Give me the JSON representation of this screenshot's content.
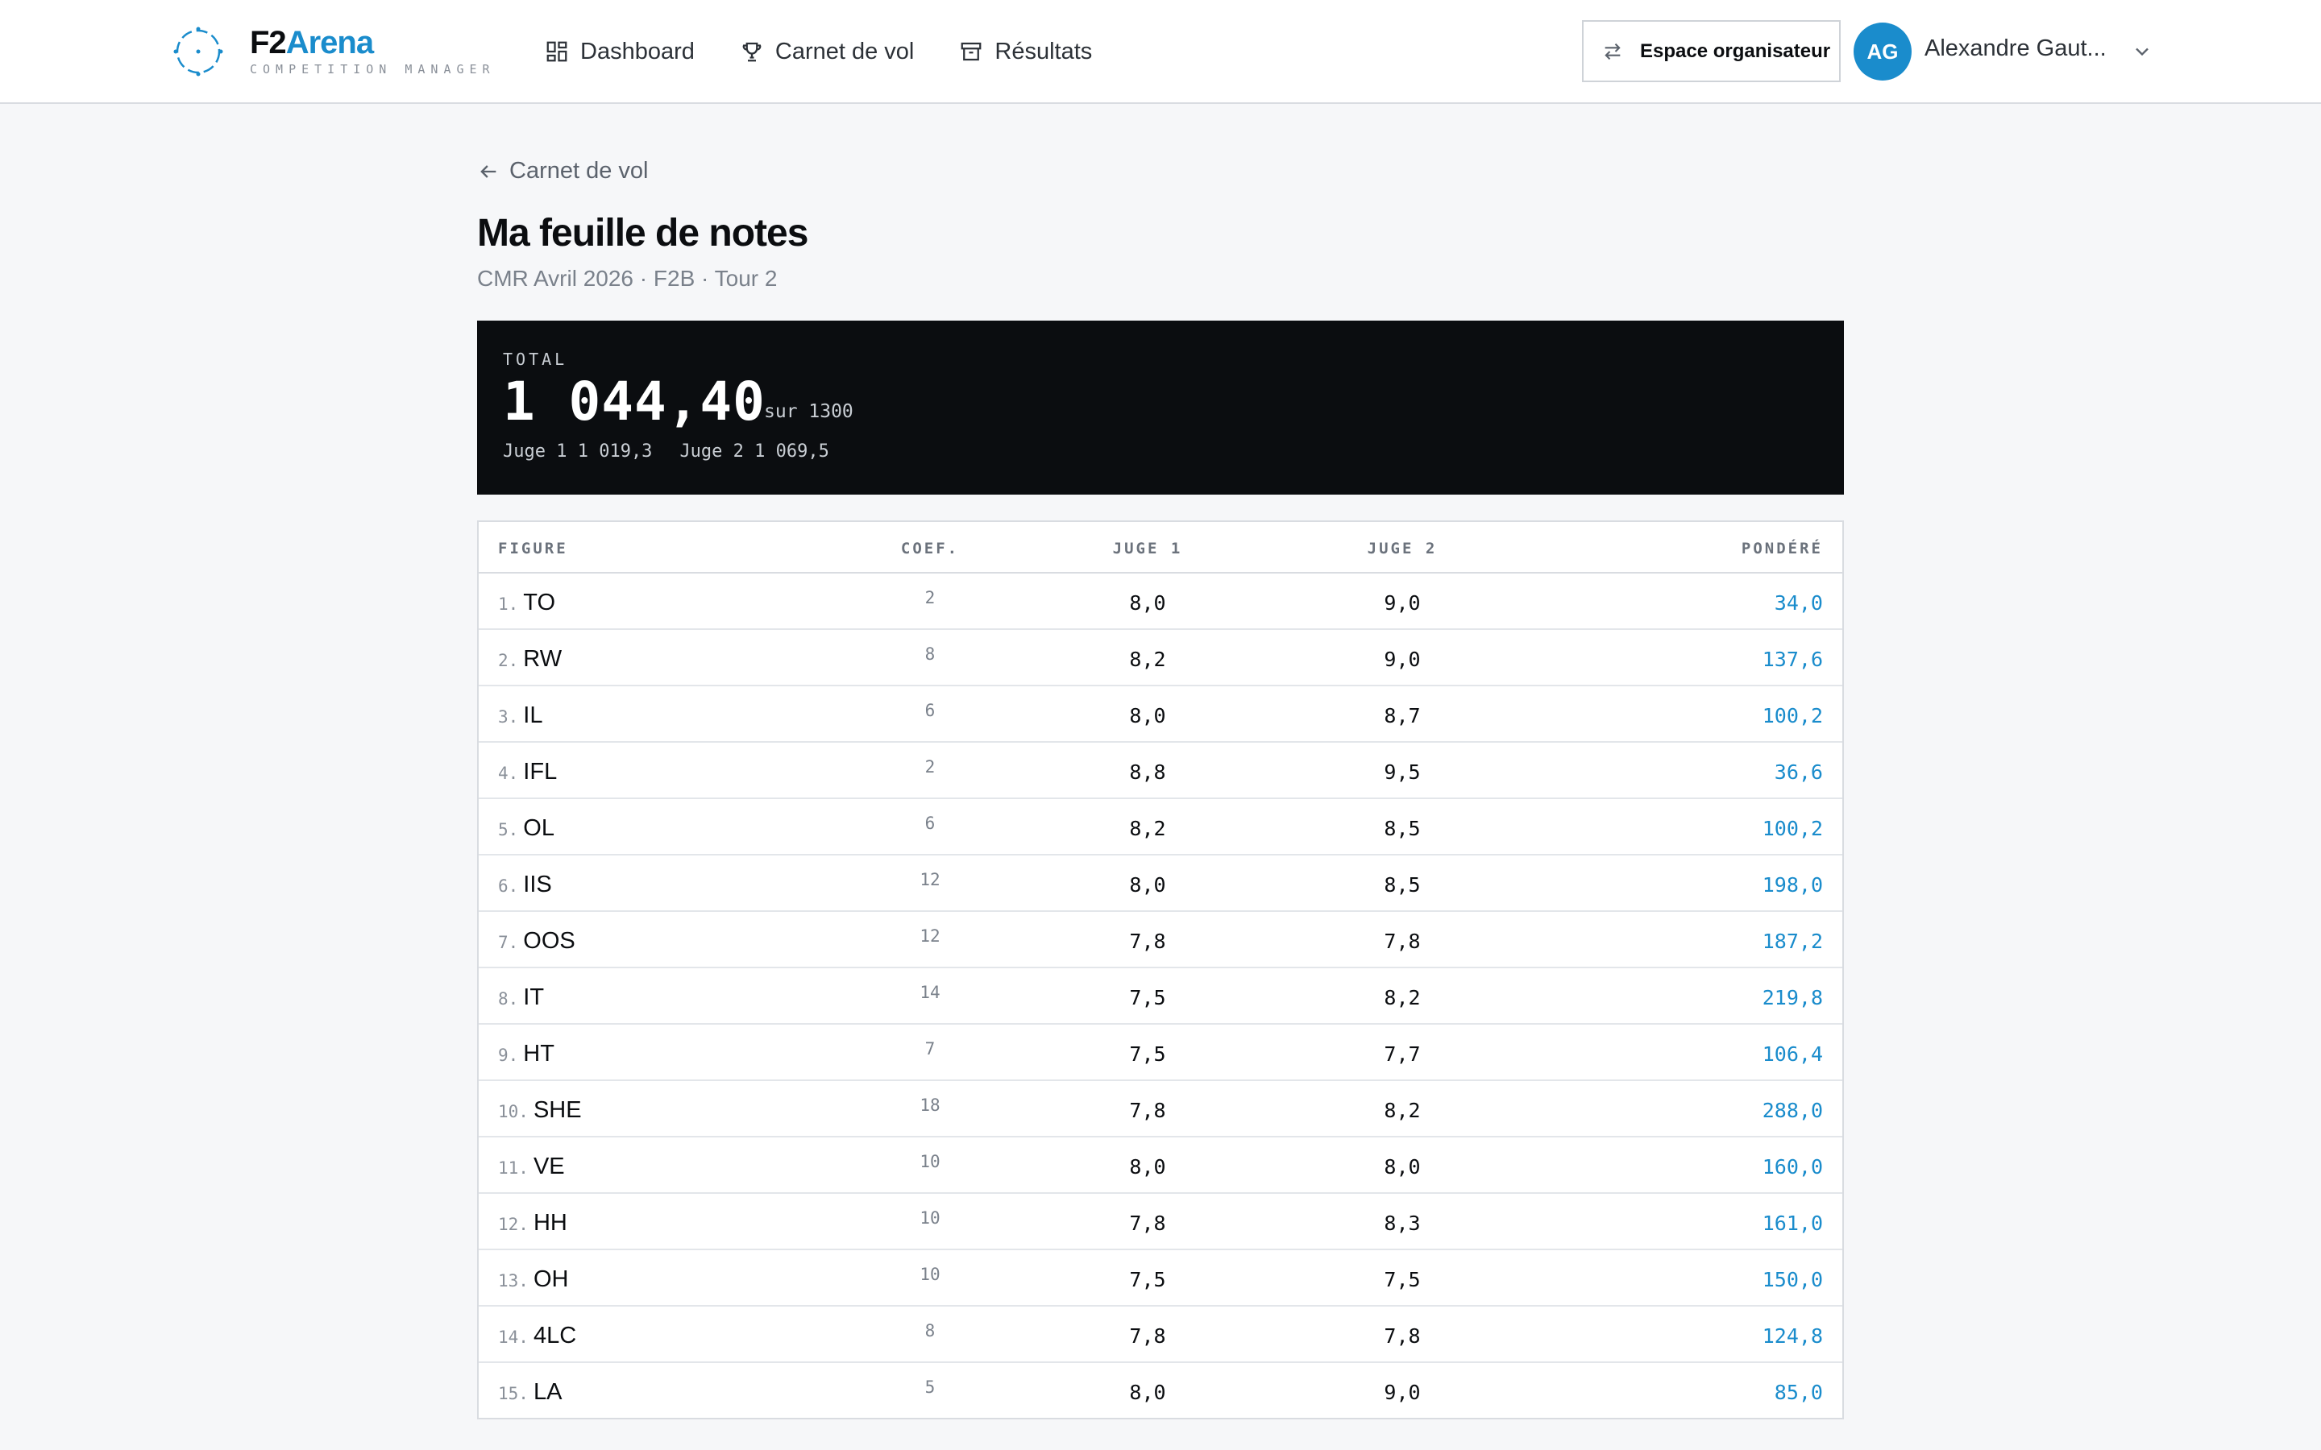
{
  "app": {
    "brand_f2": "F2",
    "brand_arena": "Arena",
    "brand_sub": "COMPETITION MANAGER"
  },
  "nav": [
    {
      "label": "Dashboard",
      "icon": "grid-icon"
    },
    {
      "label": "Carnet de vol",
      "icon": "trophy-icon"
    },
    {
      "label": "Résultats",
      "icon": "archive-icon"
    }
  ],
  "header": {
    "org_button": "Espace organisateur",
    "avatar_initials": "AG",
    "user_name": "Alexandre Gaut..."
  },
  "page": {
    "back_label": "Carnet de vol",
    "title": "Ma feuille de notes",
    "subtitle": "CMR Avril 2026 · F2B · Tour 2"
  },
  "total": {
    "label": "TOTAL",
    "value": "1 044,40",
    "max": "sur 1300",
    "judge1": "Juge 1 1 019,3",
    "judge2": "Juge 2 1 069,5"
  },
  "table": {
    "headers": {
      "figure": "FIGURE",
      "coef": "COEF.",
      "judge1": "JUGE 1",
      "judge2": "JUGE 2",
      "weighted": "PONDÉRÉ"
    },
    "rows": [
      {
        "num": "1.",
        "name": "TO",
        "coef": "2",
        "j1": "8,0",
        "j2": "9,0",
        "weighted": "34,0"
      },
      {
        "num": "2.",
        "name": "RW",
        "coef": "8",
        "j1": "8,2",
        "j2": "9,0",
        "weighted": "137,6"
      },
      {
        "num": "3.",
        "name": "IL",
        "coef": "6",
        "j1": "8,0",
        "j2": "8,7",
        "weighted": "100,2"
      },
      {
        "num": "4.",
        "name": "IFL",
        "coef": "2",
        "j1": "8,8",
        "j2": "9,5",
        "weighted": "36,6"
      },
      {
        "num": "5.",
        "name": "OL",
        "coef": "6",
        "j1": "8,2",
        "j2": "8,5",
        "weighted": "100,2"
      },
      {
        "num": "6.",
        "name": "IIS",
        "coef": "12",
        "j1": "8,0",
        "j2": "8,5",
        "weighted": "198,0"
      },
      {
        "num": "7.",
        "name": "OOS",
        "coef": "12",
        "j1": "7,8",
        "j2": "7,8",
        "weighted": "187,2"
      },
      {
        "num": "8.",
        "name": "IT",
        "coef": "14",
        "j1": "7,5",
        "j2": "8,2",
        "weighted": "219,8"
      },
      {
        "num": "9.",
        "name": "HT",
        "coef": "7",
        "j1": "7,5",
        "j2": "7,7",
        "weighted": "106,4"
      },
      {
        "num": "10.",
        "name": "SHE",
        "coef": "18",
        "j1": "7,8",
        "j2": "8,2",
        "weighted": "288,0"
      },
      {
        "num": "11.",
        "name": "VE",
        "coef": "10",
        "j1": "8,0",
        "j2": "8,0",
        "weighted": "160,0"
      },
      {
        "num": "12.",
        "name": "HH",
        "coef": "10",
        "j1": "7,8",
        "j2": "8,3",
        "weighted": "161,0"
      },
      {
        "num": "13.",
        "name": "OH",
        "coef": "10",
        "j1": "7,5",
        "j2": "7,5",
        "weighted": "150,0"
      },
      {
        "num": "14.",
        "name": "4LC",
        "coef": "8",
        "j1": "7,8",
        "j2": "7,8",
        "weighted": "124,8"
      },
      {
        "num": "15.",
        "name": "LA",
        "coef": "5",
        "j1": "8,0",
        "j2": "9,0",
        "weighted": "85,0"
      }
    ]
  },
  "colors": {
    "accent": "#1a8ccc",
    "dark": "#0b0d10",
    "background": "#f6f7f9"
  }
}
